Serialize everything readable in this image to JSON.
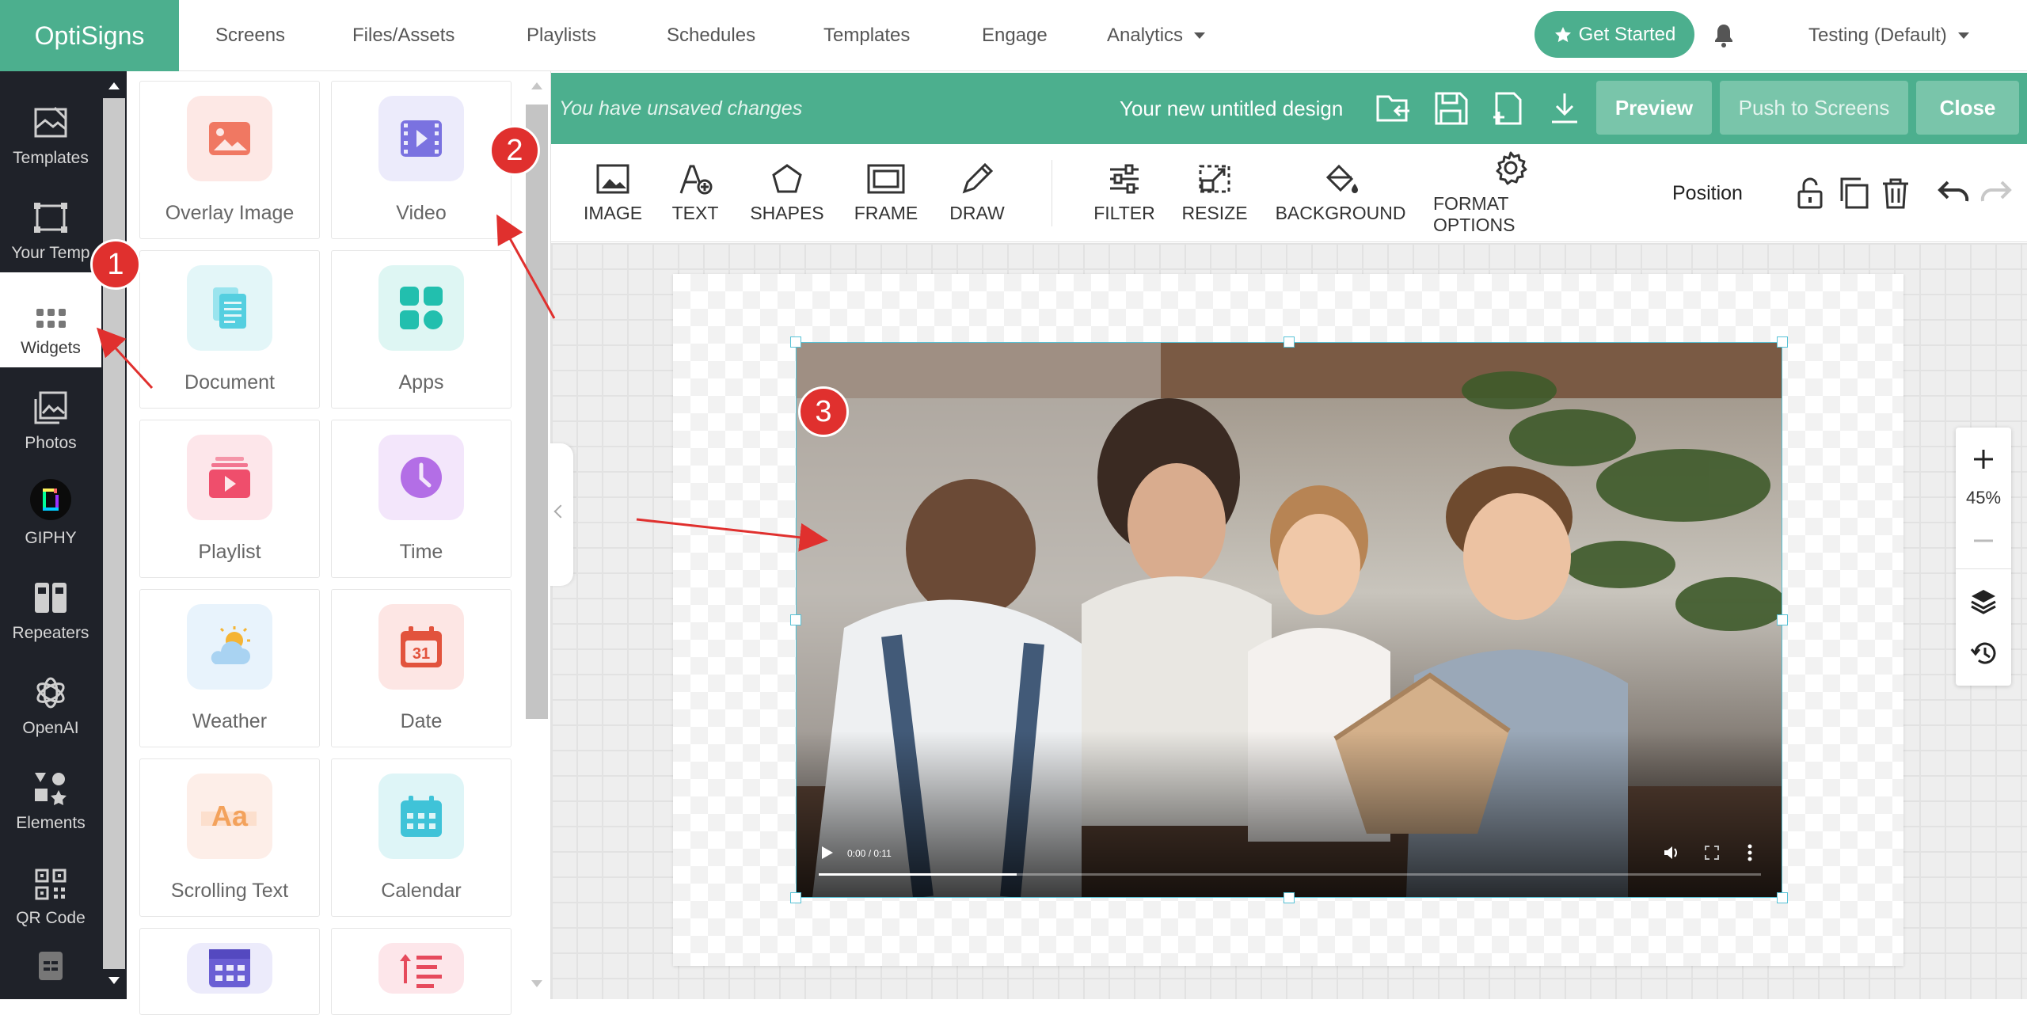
{
  "app": {
    "brand": "OptiSigns",
    "accent": "#4caf8e"
  },
  "topnav": {
    "links": [
      "Screens",
      "Files/Assets",
      "Playlists",
      "Schedules",
      "Templates",
      "Engage",
      "Analytics"
    ],
    "get_started": "Get Started",
    "account": "Testing (Default)"
  },
  "rail": {
    "items": [
      {
        "label": "Templates",
        "icon": "templates-icon"
      },
      {
        "label": "Your Temp",
        "icon": "your-templates-icon"
      },
      {
        "label": "Widgets",
        "icon": "widgets-icon",
        "active": true
      },
      {
        "label": "Photos",
        "icon": "photos-icon"
      },
      {
        "label": "GIPHY",
        "icon": "giphy-icon"
      },
      {
        "label": "Repeaters",
        "icon": "repeaters-icon"
      },
      {
        "label": "OpenAI",
        "icon": "openai-icon"
      },
      {
        "label": "Elements",
        "icon": "elements-icon"
      },
      {
        "label": "QR Code",
        "icon": "qr-code-icon"
      }
    ]
  },
  "widgets": [
    {
      "label": "Overlay Image",
      "icon": "overlay-image-icon",
      "bg": "#fde8e5",
      "color": "#f07862"
    },
    {
      "label": "Video",
      "icon": "video-icon",
      "bg": "#ecebfb",
      "color": "#7a72e0"
    },
    {
      "label": "Document",
      "icon": "document-icon",
      "bg": "#e3f6f8",
      "color": "#54cfe0"
    },
    {
      "label": "Apps",
      "icon": "apps-icon",
      "bg": "#def6f3",
      "color": "#22bfae"
    },
    {
      "label": "Playlist",
      "icon": "playlist-icon",
      "bg": "#fde6ea",
      "color": "#ef4e6c"
    },
    {
      "label": "Time",
      "icon": "time-icon",
      "bg": "#f3e6fb",
      "color": "#b36ee6"
    },
    {
      "label": "Weather",
      "icon": "weather-icon",
      "bg": "#e8f3fc",
      "color": "#f5b433"
    },
    {
      "label": "Date",
      "icon": "date-icon",
      "bg": "#fde6e4",
      "color": "#e2533d"
    },
    {
      "label": "Scrolling Text",
      "icon": "scrolling-text-icon",
      "bg": "#fdeee8",
      "color": "#f3a25c"
    },
    {
      "label": "Calendar",
      "icon": "calendar-icon",
      "bg": "#def5f7",
      "color": "#3fc3d8"
    },
    {
      "label": "",
      "icon": "table-icon",
      "bg": "#ecebfb",
      "color": "#6a5fd4"
    },
    {
      "label": "",
      "icon": "sort-list-icon",
      "bg": "#fde6ea",
      "color": "#e64a5c"
    }
  ],
  "editor": {
    "unsaved": "You have unsaved changes",
    "design_name": "Your new untitled design",
    "preview": "Preview",
    "push": "Push to Screens",
    "close": "Close",
    "tools": [
      "IMAGE",
      "TEXT",
      "SHAPES",
      "FRAME",
      "DRAW",
      "FILTER",
      "RESIZE",
      "BACKGROUND",
      "FORMAT OPTIONS"
    ],
    "position": "Position"
  },
  "video": {
    "time": "0:00 / 0:11",
    "progress": 0.21
  },
  "zoom": {
    "level": "45%"
  },
  "annotations": [
    "1",
    "2",
    "3"
  ]
}
